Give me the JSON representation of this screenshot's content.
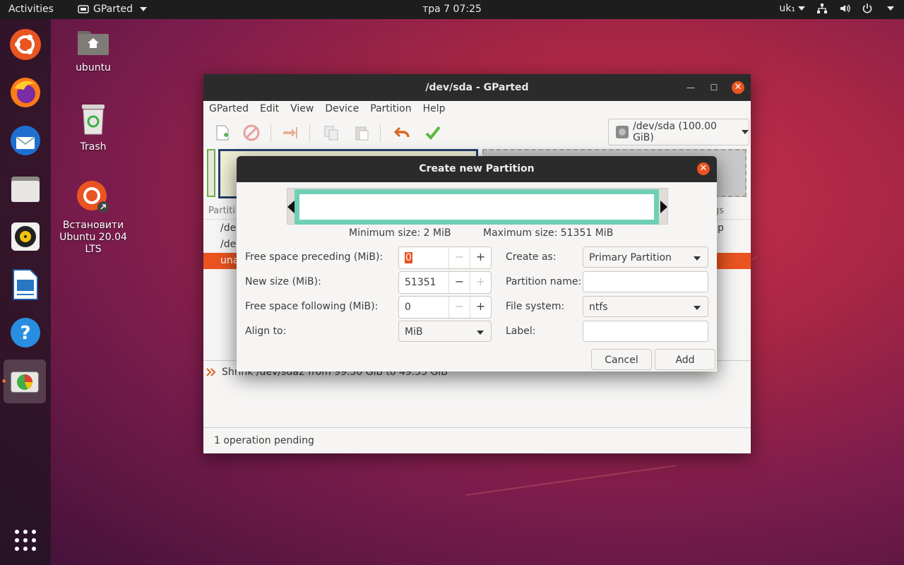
{
  "topbar": {
    "activities": "Activities",
    "app_menu": "GParted",
    "clock": "тра 7  07:25",
    "keyboard_layout": "uk₁"
  },
  "dock": {
    "items": [
      "ubuntu-software",
      "firefox",
      "thunderbird",
      "files",
      "rhythmbox",
      "libreoffice-impress",
      "help",
      "gparted"
    ],
    "show_apps": "show-applications"
  },
  "desktop": {
    "icons": [
      {
        "label": "ubuntu"
      },
      {
        "label": "Trash"
      },
      {
        "label": "Встановити Ubuntu 20.04 LTS"
      }
    ]
  },
  "window": {
    "title": "/dev/sda - GParted",
    "menu": [
      "GParted",
      "Edit",
      "View",
      "Device",
      "Partition",
      "Help"
    ],
    "device": "/dev/sda (100.00 GiB)",
    "list_header_left": "Partiti",
    "list_header_right": "gs",
    "rows": [
      {
        "left": "/de",
        "right": "p"
      },
      {
        "left": "/de",
        "right": ""
      },
      {
        "left": "una",
        "right": ""
      }
    ],
    "operation": "Shrink /dev/sda2 from 99.50 GiB to 49.35 GiB",
    "status": "1 operation pending"
  },
  "dialog": {
    "title": "Create new Partition",
    "min_size": "Minimum size: 2 MiB",
    "max_size": "Maximum size: 51351 MiB",
    "free_preceding_label": "Free space preceding (MiB):",
    "free_preceding_value": "0",
    "new_size_label": "New size (MiB):",
    "new_size_value": "51351",
    "free_following_label": "Free space following (MiB):",
    "free_following_value": "0",
    "align_label": "Align to:",
    "align_value": "MiB",
    "create_as_label": "Create as:",
    "create_as_value": "Primary Partition",
    "partition_name_label": "Partition name:",
    "partition_name_value": "",
    "file_system_label": "File system:",
    "file_system_value": "ntfs",
    "label_label": "Label:",
    "label_value": "",
    "minus": "−",
    "plus": "+",
    "cancel": "Cancel",
    "add": "Add"
  },
  "colors": {
    "accent": "#e95420",
    "partition_bar": "#6fd0b5",
    "titlebar": "#2b2b2b"
  }
}
